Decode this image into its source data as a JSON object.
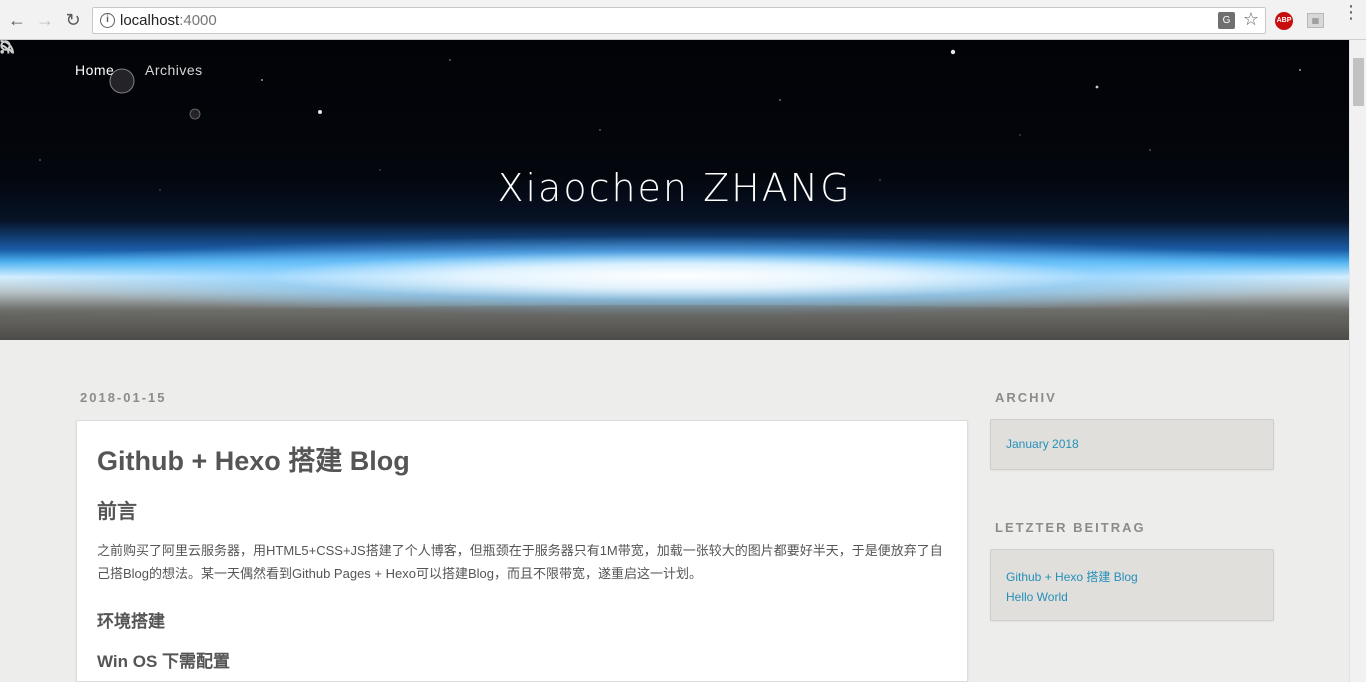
{
  "browser": {
    "url_host": "localhost",
    "url_port": ":4000",
    "abp_label": "ABP"
  },
  "site": {
    "title": "Xiaochen ZHANG",
    "nav": [
      {
        "label": "Home"
      },
      {
        "label": "Archives"
      }
    ],
    "icons": [
      "rss-icon",
      "search-icon"
    ]
  },
  "post": {
    "date": "2018-01-15",
    "title": "Github + Hexo 搭建 Blog",
    "section_heading": "前言",
    "paragraph": "之前购买了阿里云服务器，用HTML5+CSS+JS搭建了个人博客，但瓶颈在于服务器只有1M带宽，加载一张较大的图片都要好半天，于是便放弃了自己搭Blog的想法。某一天偶然看到Github Pages + Hexo可以搭建Blog，而且不限带宽，遂重启这一计划。",
    "subheading": "环境搭建",
    "subsubheading": "Win OS 下需配置"
  },
  "sidebar": {
    "archive_title": "ARCHIV",
    "archive_items": [
      {
        "label": "January 2018"
      }
    ],
    "recent_title": "LETZTER BEITRAG",
    "recent_items": [
      {
        "label": "Github + Hexo 搭建 Blog"
      },
      {
        "label": "Hello World"
      }
    ]
  },
  "colors": {
    "link": "#258fb8",
    "page_bg": "#ededeb",
    "text": "#555555"
  }
}
